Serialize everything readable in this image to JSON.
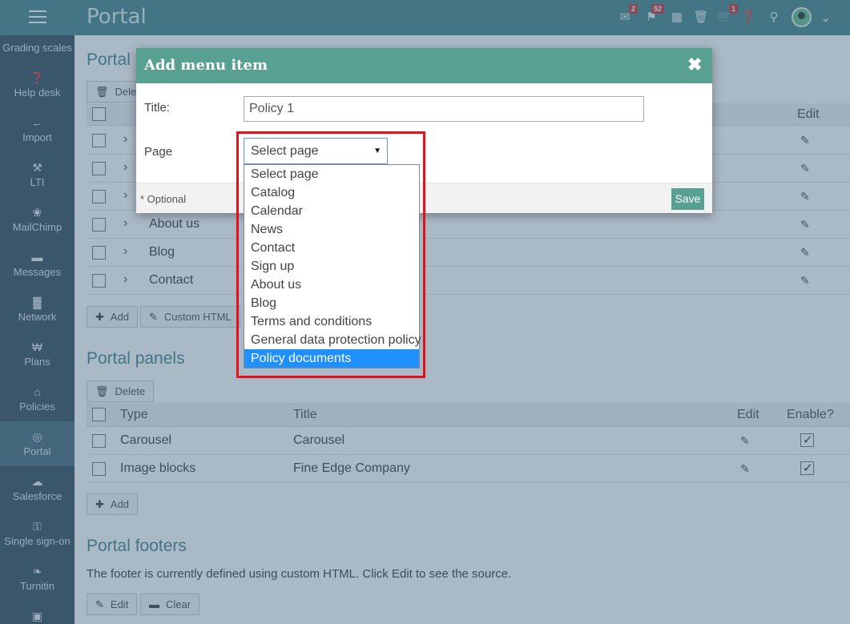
{
  "app": {
    "title": "Portal"
  },
  "topbar": {
    "badges": {
      "messages": "2",
      "notifications": "52",
      "cart": "1"
    }
  },
  "sidebar": {
    "items": [
      {
        "label": "Grading scales",
        "icon": "grading-icon"
      },
      {
        "label": "Help desk",
        "icon": "help-icon"
      },
      {
        "label": "Import",
        "icon": "import-icon"
      },
      {
        "label": "LTI",
        "icon": "wrench-icon"
      },
      {
        "label": "MailChimp",
        "icon": "mailchimp-icon"
      },
      {
        "label": "Messages",
        "icon": "chat-icon"
      },
      {
        "label": "Network",
        "icon": "network-icon"
      },
      {
        "label": "Plans",
        "icon": "plans-icon"
      },
      {
        "label": "Policies",
        "icon": "lock-icon"
      },
      {
        "label": "Portal",
        "icon": "globe-icon",
        "active": true
      },
      {
        "label": "Salesforce",
        "icon": "salesforce-icon"
      },
      {
        "label": "Single sign-on",
        "icon": "sso-icon"
      },
      {
        "label": "Turnitin",
        "icon": "turnitin-icon"
      },
      {
        "label": "",
        "icon": "monitor-icon"
      }
    ]
  },
  "main": {
    "menu_section": {
      "title": "Portal",
      "delete_label": "Delete",
      "header_edit": "Edit",
      "rows": [
        "",
        "",
        "",
        "About us",
        "Blog",
        "Contact"
      ],
      "add_label": "Add",
      "custom_html_label": "Custom HTML"
    },
    "panels_section": {
      "title": "Portal panels",
      "delete_label": "Delete",
      "headers": {
        "type": "Type",
        "title": "Title",
        "edit": "Edit",
        "enable": "Enable?"
      },
      "rows": [
        {
          "type": "Carousel",
          "title": "Carousel",
          "enabled": true
        },
        {
          "type": "Image blocks",
          "title": "Fine Edge Company",
          "enabled": true
        }
      ],
      "add_label": "Add"
    },
    "footers_section": {
      "title": "Portal footers",
      "text": "The footer is currently defined using custom HTML. Click Edit to see the source.",
      "edit_label": "Edit",
      "clear_label": "Clear"
    }
  },
  "modal": {
    "title": "Add menu item",
    "title_label": "Title:",
    "title_value": "Policy 1",
    "page_label": "Page",
    "select_value": "Select page",
    "optional_label": "* Optional",
    "save_label": "Save",
    "options": [
      "Select page",
      "Catalog",
      "Calendar",
      "News",
      "Contact",
      "Sign up",
      "About us",
      "Blog",
      "Terms and conditions",
      "General data protection policy",
      "Policy documents"
    ],
    "selected_option": "Policy documents"
  },
  "colors": {
    "topbar": "#4e8b8f",
    "sidebar": "#3f5563",
    "accent": "#58a091",
    "highlight": "#e3121a",
    "selected_option": "#1e90ff"
  }
}
